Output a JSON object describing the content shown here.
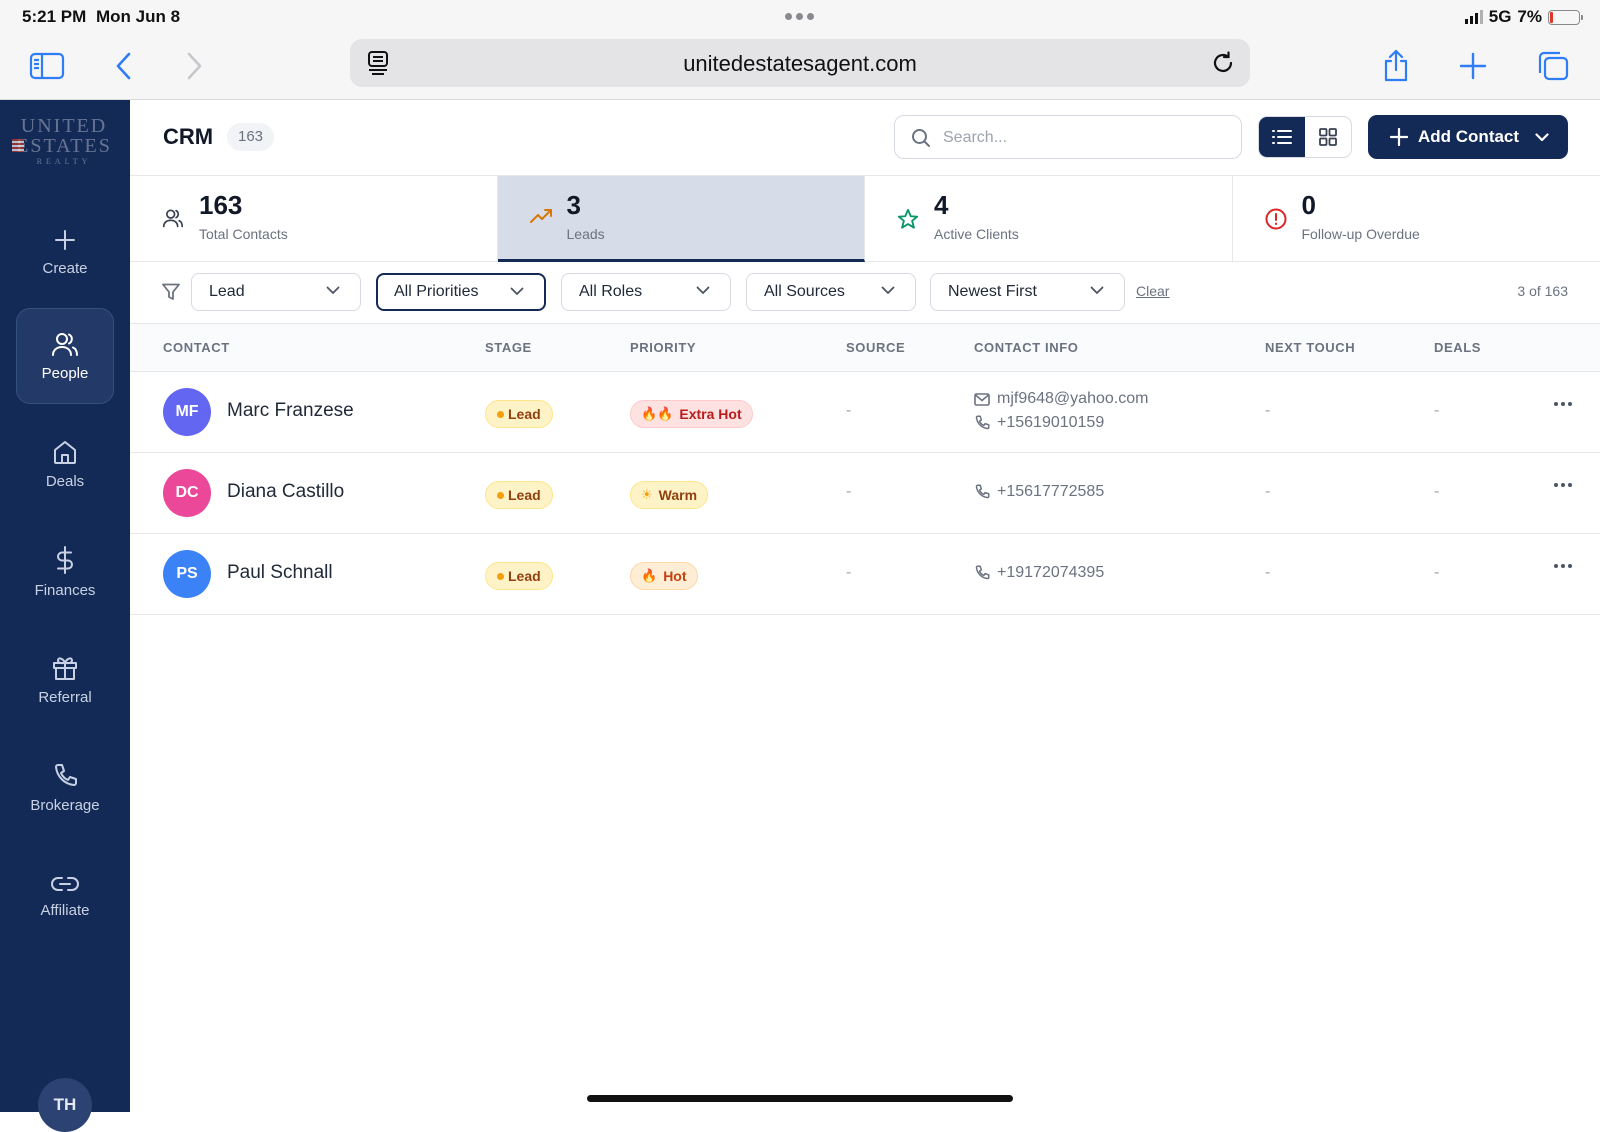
{
  "status_bar": {
    "time": "5:21 PM",
    "date": "Mon Jun 8",
    "network": "5G",
    "battery": "7%",
    "battery_level": 0.07
  },
  "browser": {
    "url": "unitedestatesagent.com"
  },
  "brand": {
    "logo_line1": "UNITED",
    "logo_line2": "ESTATES",
    "logo_line3": "REALTY"
  },
  "sidebar": {
    "items": [
      {
        "label": "Create",
        "icon": "plus-icon"
      },
      {
        "label": "People",
        "icon": "people-icon",
        "active": true
      },
      {
        "label": "Deals",
        "icon": "home-icon"
      },
      {
        "label": "Finances",
        "icon": "dollar-icon"
      },
      {
        "label": "Referral",
        "icon": "gift-icon"
      },
      {
        "label": "Brokerage",
        "icon": "phone-icon"
      },
      {
        "label": "Affiliate",
        "icon": "link-icon"
      }
    ],
    "user_initials": "TH"
  },
  "header": {
    "title": "CRM",
    "count": "163",
    "search_placeholder": "Search...",
    "add_contact_label": "Add Contact"
  },
  "stats": [
    {
      "value": "163",
      "label": "Total Contacts",
      "icon": "people-icon"
    },
    {
      "value": "3",
      "label": "Leads",
      "icon": "trending-up-icon",
      "active": true
    },
    {
      "value": "4",
      "label": "Active Clients",
      "icon": "star-icon"
    },
    {
      "value": "0",
      "label": "Follow-up Overdue",
      "icon": "alert-circle-icon"
    }
  ],
  "filters": {
    "stage": "Lead",
    "priority": "All Priorities",
    "role": "All Roles",
    "source": "All Sources",
    "sort": "Newest First",
    "clear_label": "Clear",
    "range_label": "3 of 163"
  },
  "table": {
    "columns": [
      "CONTACT",
      "STAGE",
      "PRIORITY",
      "SOURCE",
      "CONTACT INFO",
      "NEXT TOUCH",
      "DEALS"
    ],
    "rows": [
      {
        "initials": "MF",
        "name": "Marc Franzese",
        "stage": "Lead",
        "priority_emoji": "🔥🔥",
        "priority": "Extra Hot",
        "source": "-",
        "email": "mjf9648@yahoo.com",
        "phone": "+15619010159",
        "next_touch": "-",
        "deals": "-"
      },
      {
        "initials": "DC",
        "name": "Diana Castillo",
        "stage": "Lead",
        "priority_emoji": "☀",
        "priority": "Warm",
        "source": "-",
        "phone": "+15617772585",
        "next_touch": "-",
        "deals": "-"
      },
      {
        "initials": "PS",
        "name": "Paul Schnall",
        "stage": "Lead",
        "priority_emoji": "🔥",
        "priority": "Hot",
        "source": "-",
        "phone": "+19172074395",
        "next_touch": "-",
        "deals": "-"
      }
    ]
  },
  "colors": {
    "navy": "#142a56",
    "avatar_mf": "#6366f1",
    "avatar_dc": "#ec4899",
    "avatar_ps": "#3b82f6"
  }
}
